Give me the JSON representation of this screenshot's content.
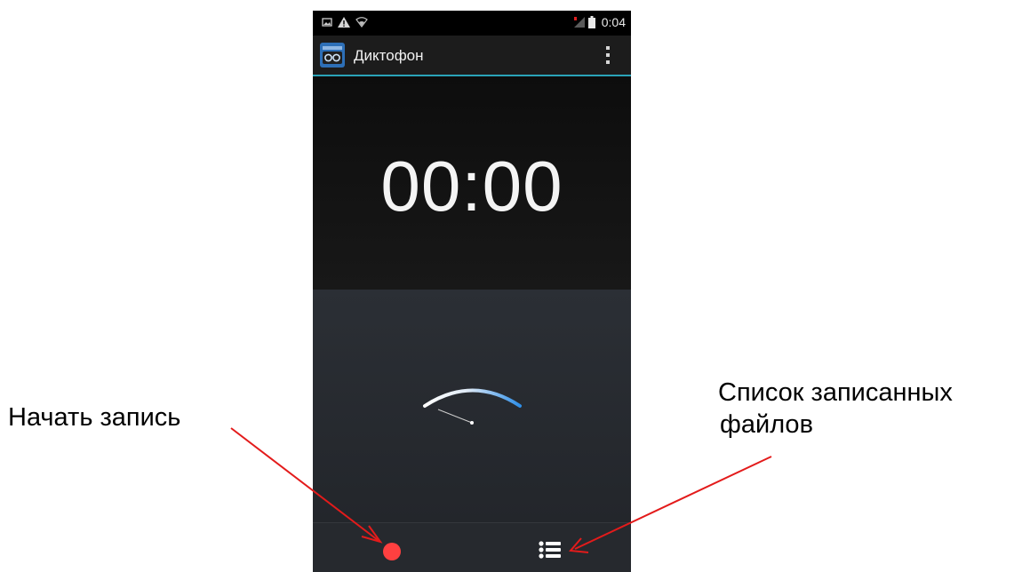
{
  "status_bar": {
    "clock": "0:04",
    "icons": [
      "image-notification-icon",
      "warning-icon",
      "wifi-icon",
      "signal-icon",
      "battery-icon"
    ]
  },
  "action_bar": {
    "title": "Диктофон",
    "app_icon": "voice-recorder-icon",
    "menu_icon": "overflow-menu-icon"
  },
  "timer": {
    "value": "00:00"
  },
  "meter": {
    "icon": "vu-meter-gauge",
    "level": 0
  },
  "controls": {
    "record_icon": "record-icon",
    "list_icon": "list-icon"
  },
  "annotations": {
    "start_recording": "Начать запись",
    "recorded_files_line1": "Список записанных",
    "recorded_files_line2": "файлов"
  },
  "colors": {
    "accent": "#2aa3b8",
    "record": "#ff4040",
    "arrow": "#e31b1b",
    "meter_blue": "#2f8fe8"
  }
}
